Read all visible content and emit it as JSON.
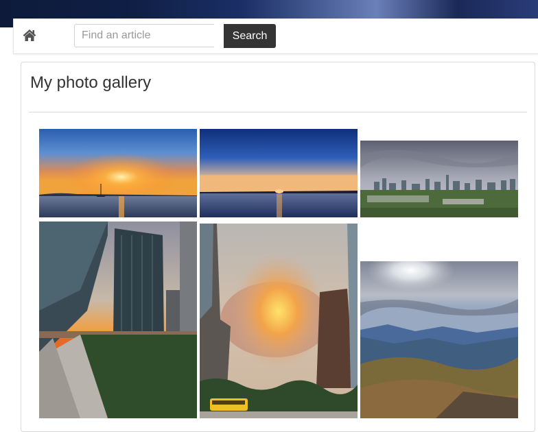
{
  "navbar": {
    "home_icon": "home-icon",
    "search": {
      "placeholder": "Find an article",
      "value": "",
      "button_label": "Search"
    }
  },
  "gallery": {
    "title": "My photo gallery",
    "photos": [
      {
        "subject": "sunset over the sea with a sailboat"
      },
      {
        "subject": "sunset on the horizon over calm water"
      },
      {
        "subject": "city skyline under a cloudy sky"
      },
      {
        "subject": "glass office towers at sunset above a green roof walkway"
      },
      {
        "subject": "sunlit clouds between skyscrapers with a yellow bus"
      },
      {
        "subject": "sun over mountain valley with a hazy range"
      }
    ]
  },
  "colors": {
    "banner_dark": "#0d1a3a",
    "search_button": "#343434",
    "title_text": "#333333"
  }
}
